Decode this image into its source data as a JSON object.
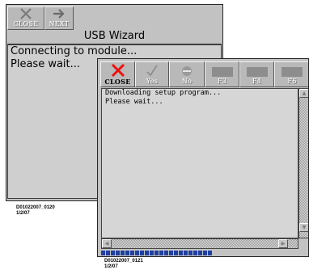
{
  "screen1": {
    "toolbar": [
      {
        "label": "CLOSE",
        "icon": "x-icon"
      },
      {
        "label": "NEXT",
        "icon": "right-arrow-icon"
      }
    ],
    "title": "USB Wizard",
    "lines": [
      "Connecting to module...",
      "Please wait..."
    ],
    "caption_line1": "D01022007_0120",
    "caption_line2": "1/2/07"
  },
  "screen2": {
    "toolbar": [
      {
        "label": "CLOSE",
        "icon": "red-x-icon"
      },
      {
        "label": "Yes",
        "icon": "checkmark-icon"
      },
      {
        "label": "No",
        "icon": "minus-circle-icon"
      },
      {
        "label": "F3",
        "icon": "blank-icon"
      },
      {
        "label": "F4",
        "icon": "blank-icon"
      },
      {
        "label": "F6",
        "icon": "blank-icon"
      }
    ],
    "lines": [
      "Downloading setup program...",
      "Please wait..."
    ],
    "caption_line1": "D01022007_0121",
    "caption_line2": "1/2/07",
    "progress_segments": 23
  },
  "colors": {
    "close_x": "#ee1111",
    "progress": "#1f3fa0",
    "screen_bg": "#c2c2c2"
  }
}
